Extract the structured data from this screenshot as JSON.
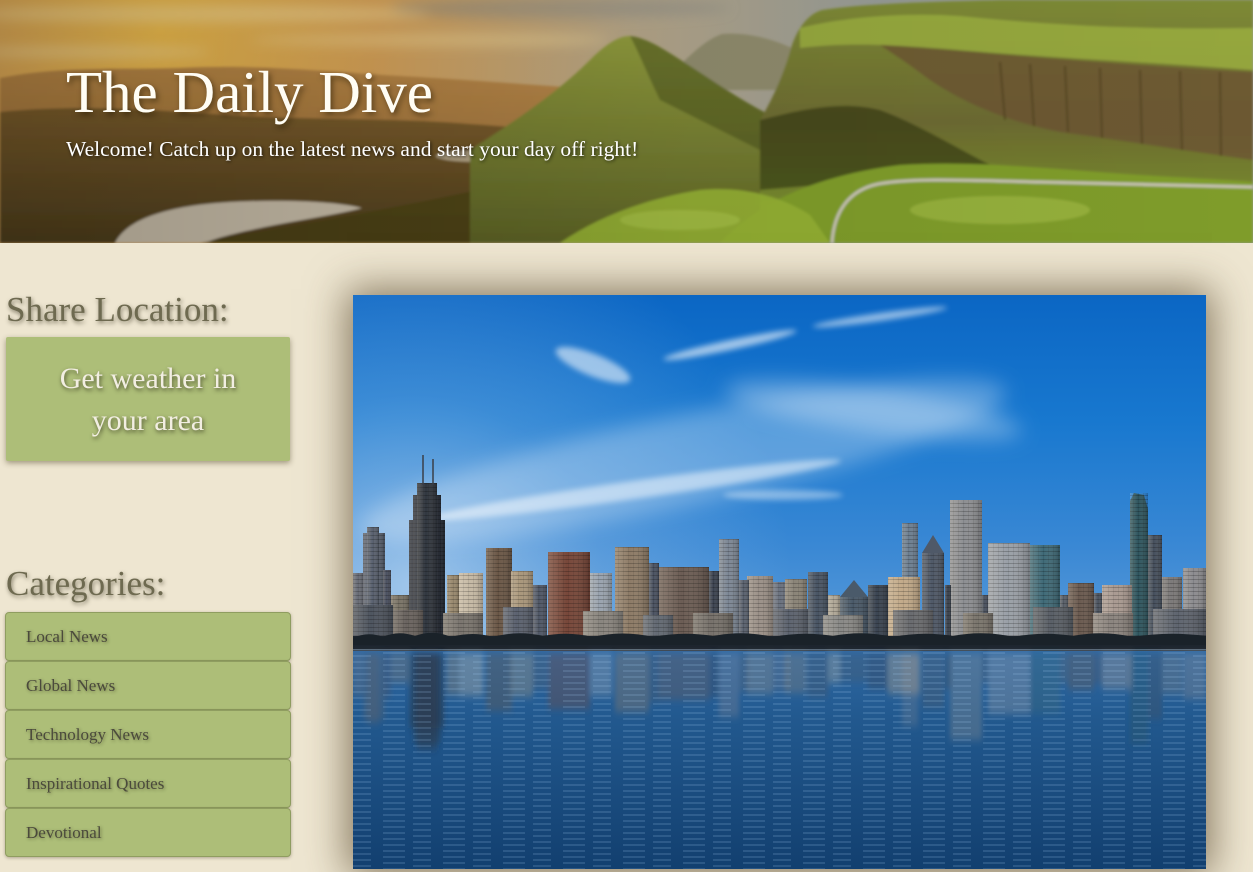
{
  "header": {
    "title": "The Daily Dive",
    "subtitle": "Welcome! Catch up on the latest news and start your day off right!"
  },
  "sidebar": {
    "share_heading": "Share Location:",
    "weather_button": "Get weather in your area",
    "categories_heading": "Categories:",
    "categories": [
      {
        "label": "Local News"
      },
      {
        "label": "Global News"
      },
      {
        "label": "Technology News"
      },
      {
        "label": "Inspirational Quotes"
      },
      {
        "label": "Devotional"
      }
    ]
  },
  "colors": {
    "page_background": "#eee6d1",
    "accent": "#adbe78",
    "accent_border": "#8f9d60",
    "heading_text": "#6e6a50",
    "button_text": "#f2eee2",
    "category_text": "#4b4a3c",
    "title_text": "#fffdf4"
  }
}
